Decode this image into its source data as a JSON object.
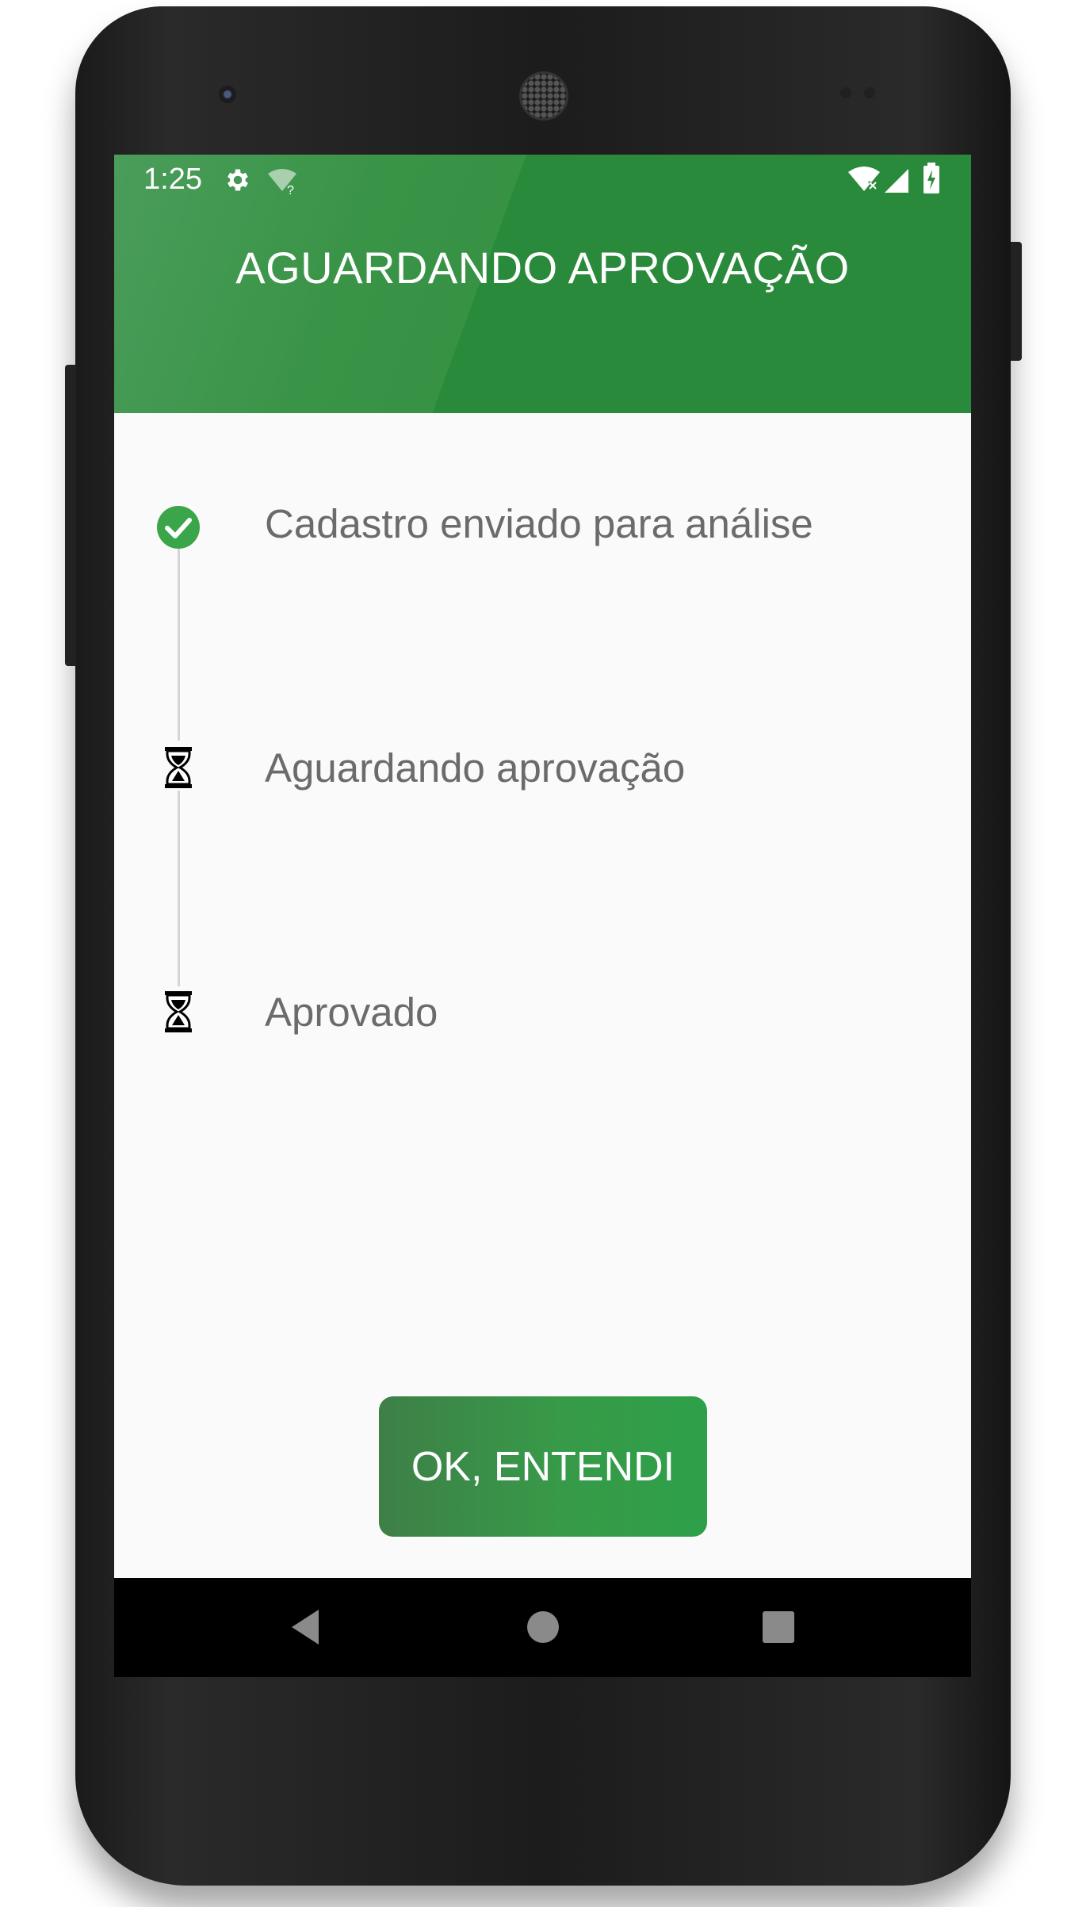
{
  "status_bar": {
    "time": "1:25",
    "icons": [
      "settings-icon",
      "wifi-unknown-icon",
      "wifi-off-icon",
      "signal-icon",
      "battery-charging-icon"
    ],
    "wifi_unknown_glyph": "?"
  },
  "header": {
    "title": "AGUARDANDO APROVAÇÃO",
    "color": "#2a8a3b"
  },
  "steps": [
    {
      "label": "Cadastro enviado para análise",
      "icon": "check-circle-icon",
      "status": "done"
    },
    {
      "label": "Aguardando aprovação",
      "icon": "hourglass-icon",
      "status": "pending"
    },
    {
      "label": "Aprovado",
      "icon": "hourglass-icon",
      "status": "pending"
    }
  ],
  "action": {
    "ok_label": "OK, ENTENDI"
  },
  "nav": {
    "items": [
      "back-icon",
      "home-icon",
      "recents-icon"
    ]
  }
}
